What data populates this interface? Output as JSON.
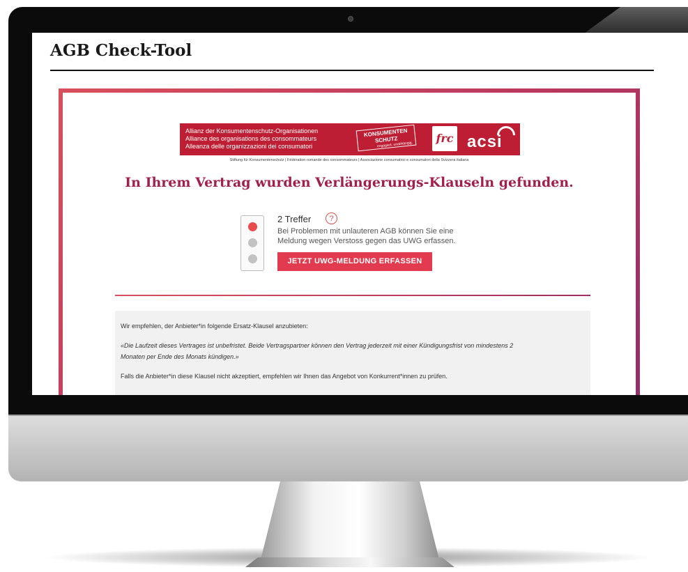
{
  "page": {
    "title": "AGB Check-Tool"
  },
  "banner": {
    "lines": [
      "Allianz der Konsumentenschutz-Organisationen",
      "Alliance des organisations des consommateurs",
      "Alleanza delle organizzazioni dei consumatori"
    ],
    "logo_ks_line1": "KONSUMENTEN",
    "logo_ks_line2": "SCHUTZ",
    "logo_ks_tagline": "engagiert. unabhängig.",
    "logo_frc": "frc",
    "logo_acsi": "acsi",
    "foundation_line": "Stiftung für Konsumentenschutz | Fédération romande des consommateurs | Associazione consumatrici e consumatori della Svizzera italiana"
  },
  "result": {
    "headline": "In Ihrem Vertrag wurden Verlängerungs-Klauseln gefunden.",
    "hits": "2 Treffer",
    "help_symbol": "?",
    "hint_line1": "Bei Problemen mit unlauteren AGB können Sie eine",
    "hint_line2": "Meldung wegen Verstoss gegen das UWG erfassen.",
    "cta_label": "JETZT UWG-MELDUNG ERFASSEN",
    "traffic_light": {
      "active": "red",
      "active_color": "#e84c4c",
      "inactive_color": "#c2c2c2"
    }
  },
  "recommendation": {
    "intro": "Wir empfehlen, der Anbieter*in folgende Ersatz-Klausel anzubieten:",
    "clause_line1": "«Die Laufzeit dieses Vertrages ist unbefristet. Beide Vertragspartner können den Vertrag jederzeit mit einer Kündigungsfrist von mindestens 2",
    "clause_line2": "Monaten per Ende des Monats kündigen.»",
    "followup": "Falls die Anbieter*in diese Klausel nicht akzeptiert, empfehlen wir Ihnen das Angebot von Konkurrent*innen zu prüfen."
  },
  "colors": {
    "accent": "#e23a4f",
    "headline": "#a11f4d",
    "banner": "#bd1e33",
    "blue_circle": "#1eb4ea"
  }
}
